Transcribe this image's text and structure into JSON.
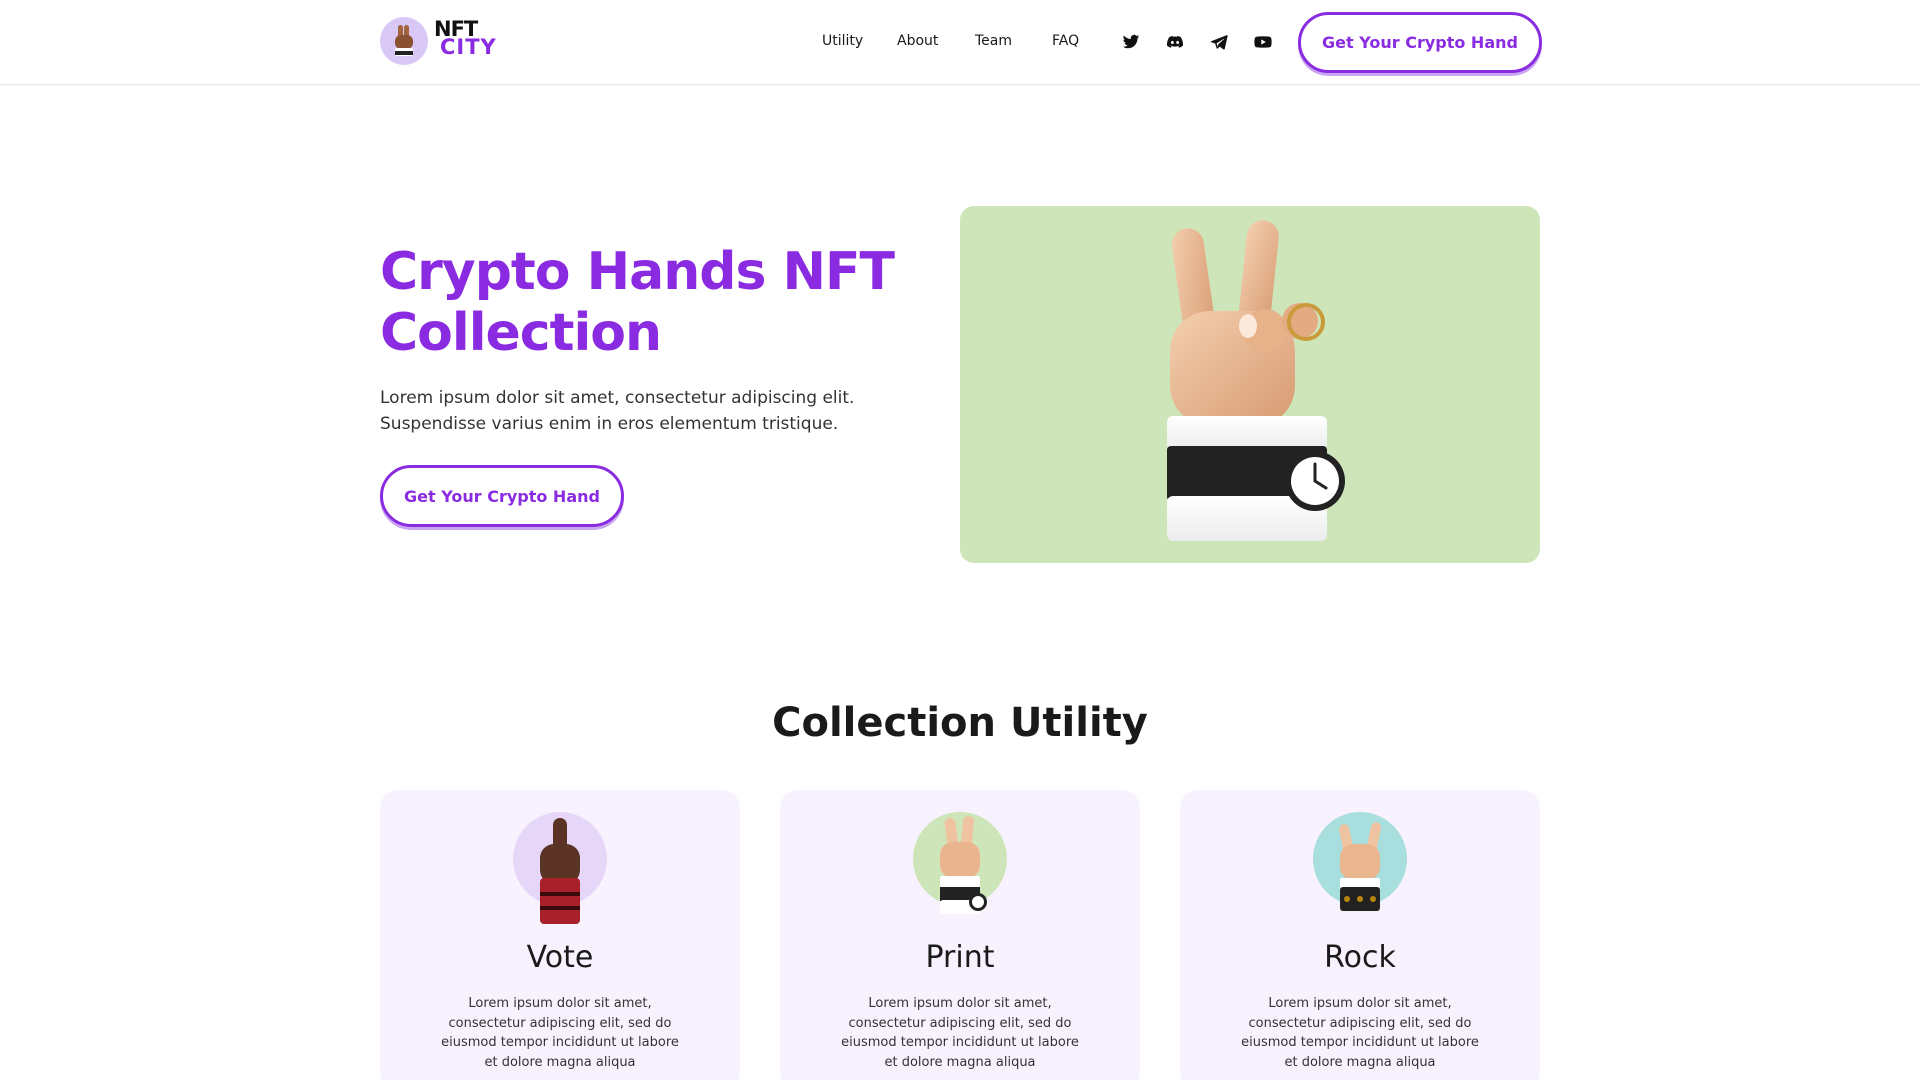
{
  "brand": {
    "line1": "NFT",
    "line2": "CITY"
  },
  "nav": {
    "items": [
      "Utility",
      "About",
      "Team",
      "FAQ"
    ]
  },
  "social": [
    "twitter-icon",
    "discord-icon",
    "telegram-icon",
    "youtube-icon"
  ],
  "header_cta": "Get Your Crypto Hand",
  "hero": {
    "title": "Crypto Hands NFT Collection",
    "text": "Lorem ipsum dolor sit amet, consectetur adipiscing elit. Suspendisse varius enim in eros elementum tristique.",
    "cta": "Get Your Crypto Hand"
  },
  "utility": {
    "title": "Collection Utility",
    "cards": [
      {
        "title": "Vote",
        "text": "Lorem ipsum dolor sit amet, consectetur adipiscing elit, sed do eiusmod tempor incididunt ut labore et dolore magna aliqua",
        "bg": "#e6d6f8"
      },
      {
        "title": "Print",
        "text": "Lorem ipsum dolor sit amet, consectetur adipiscing elit, sed do eiusmod tempor incididunt ut labore et dolore magna aliqua",
        "bg": "#cde5b8"
      },
      {
        "title": "Rock",
        "text": "Lorem ipsum dolor sit amet, consectetur adipiscing elit, sed do eiusmod tempor incididunt ut labore et dolore magna aliqua",
        "bg": "#a9dede"
      }
    ]
  },
  "colors": {
    "accent": "#8a2be2",
    "card_bg": "#f7f2fd",
    "hero_image_bg": "#cde5b8"
  }
}
